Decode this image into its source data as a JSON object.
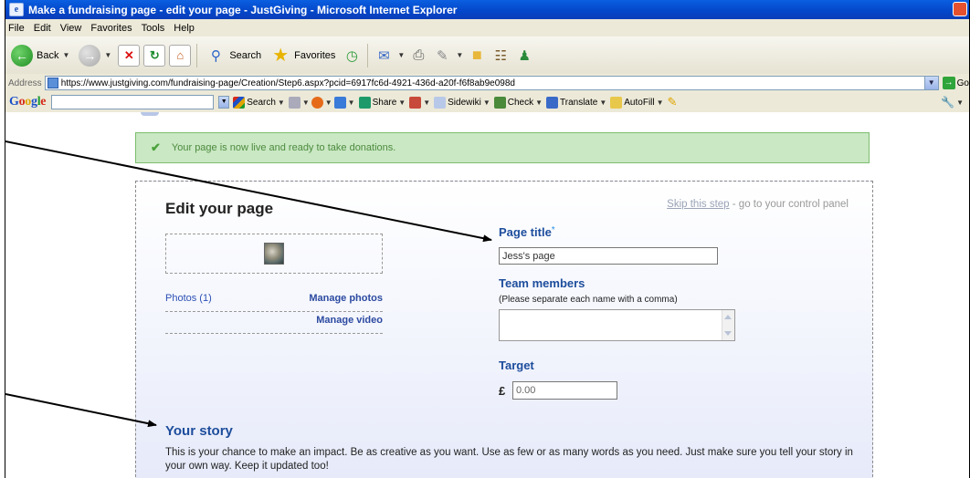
{
  "window": {
    "title": "Make a fundraising page - edit your page - JustGiving - Microsoft Internet Explorer"
  },
  "menu": [
    "File",
    "Edit",
    "View",
    "Favorites",
    "Tools",
    "Help"
  ],
  "toolbar": {
    "back_label": "Back",
    "search_label": "Search",
    "favorites_label": "Favorites"
  },
  "address": {
    "label": "Address",
    "url": "https://www.justgiving.com/fundraising-page/Creation/Step6.aspx?pcid=6917fc6d-4921-436d-a20f-f6f8ab9e098d",
    "go_label": "Go"
  },
  "google_bar": {
    "logo": [
      "G",
      "o",
      "o",
      "g",
      "l",
      "e"
    ],
    "search_label": "Search",
    "share_label": "Share",
    "sidewiki_label": "Sidewiki",
    "check_label": "Check",
    "translate_label": "Translate",
    "autofill_label": "AutoFill"
  },
  "page": {
    "success_message": "Your page is now live and ready to take donations.",
    "heading": "Edit your page",
    "skip_link": "Skip this step",
    "skip_suffix": " - go to your control panel",
    "photos_count": "Photos (1)",
    "manage_photos": "Manage photos",
    "manage_video": "Manage video",
    "page_title_label": "Page title",
    "required_mark": "*",
    "page_title_value": "Jess's page",
    "team_members_label": "Team members",
    "team_members_hint": "(Please separate each name with a comma)",
    "team_members_value": "",
    "target_label": "Target",
    "currency": "£",
    "target_value": "0.00",
    "story_heading": "Your story",
    "story_text": "This is your chance to make an impact. Be as creative as you want. Use as few or as many words as you need. Just make sure you tell your story in your own way. Keep it updated too!"
  },
  "colors": {
    "titlebar": "#0446c9",
    "success_bg": "#c9e8c3",
    "success_text": "#4e8a3f",
    "label_blue": "#1d4d9c"
  }
}
